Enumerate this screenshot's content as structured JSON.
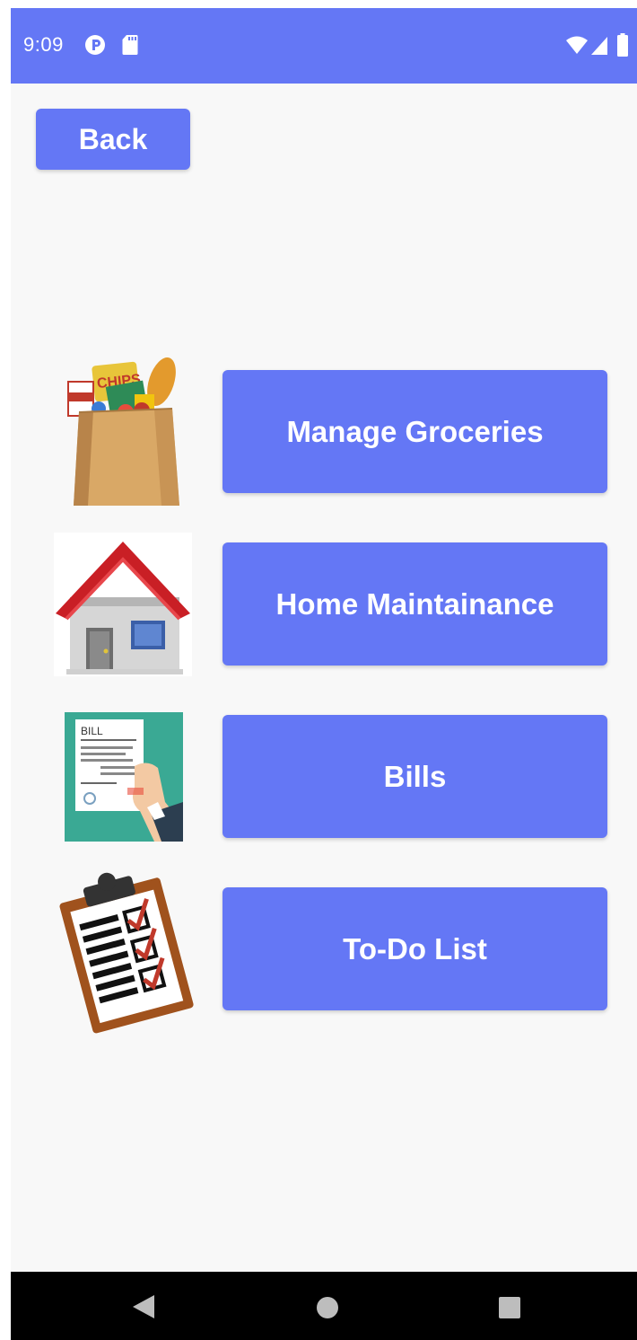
{
  "status_bar": {
    "time": "9:09",
    "icons": [
      "app-notification-icon",
      "sd-card-icon",
      "wifi-icon",
      "signal-icon",
      "battery-icon"
    ]
  },
  "back_button": {
    "label": "Back"
  },
  "menu": [
    {
      "label": "Manage Groceries",
      "icon": "grocery-bag-icon"
    },
    {
      "label": "Home Maintainance",
      "icon": "house-icon"
    },
    {
      "label": "Bills",
      "icon": "bill-icon"
    },
    {
      "label": "To-Do List",
      "icon": "clipboard-checklist-icon"
    }
  ],
  "nav_bar": {
    "icons": [
      "back-triangle-icon",
      "home-circle-icon",
      "recents-square-icon"
    ]
  },
  "colors": {
    "primary": "#6477f5",
    "background": "#f8f8f8",
    "nav_bar": "#000000"
  }
}
